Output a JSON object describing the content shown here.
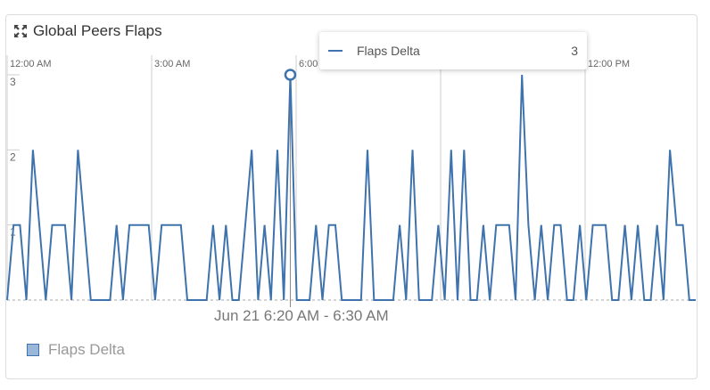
{
  "panel": {
    "title": "Global Peers Flaps",
    "icon": "expand-icon"
  },
  "tooltip": {
    "series": "Flaps Delta",
    "value": "3"
  },
  "hover_range": "Jun 21 6:20 AM - 6:30 AM",
  "legend": {
    "label": "Flaps Delta",
    "color": "#9ab6d8"
  },
  "colors": {
    "line": "#3e73ad",
    "grid": "#cfcfcf"
  },
  "chart_data": {
    "type": "line",
    "title": "Global Peers Flaps",
    "x_tick_labels": [
      "12:00 AM",
      "3:00 AM",
      "6:00",
      "",
      "12:00 PM"
    ],
    "y_tick_labels": [
      "3",
      "2",
      "1"
    ],
    "ylim": [
      0,
      3
    ],
    "interval_minutes": 10,
    "series": [
      {
        "name": "Flaps Delta",
        "values": [
          0,
          1,
          1,
          0,
          2,
          1,
          0,
          1,
          1,
          1,
          0,
          2,
          1,
          0,
          0,
          0,
          0,
          1,
          0,
          1,
          1,
          1,
          1,
          0,
          1,
          1,
          1,
          1,
          0,
          0,
          0,
          0,
          1,
          0,
          1,
          0,
          0,
          1,
          2,
          0,
          1,
          0,
          2,
          0,
          3,
          0,
          0,
          0,
          1,
          0,
          1,
          1,
          0,
          0,
          0,
          0,
          2,
          0,
          0,
          0,
          0,
          1,
          0,
          2,
          0,
          0,
          0,
          1,
          0,
          2,
          0,
          2,
          0,
          0,
          1,
          0,
          1,
          1,
          1,
          0,
          3,
          1,
          0,
          1,
          0,
          1,
          1,
          0,
          0,
          1,
          0,
          1,
          1,
          1,
          0,
          0,
          1,
          0,
          1,
          0,
          0,
          1,
          0,
          2,
          1,
          1,
          0,
          0
        ]
      }
    ],
    "hover": {
      "index": 44,
      "value": 3
    },
    "grid": true,
    "legend_position": "bottom-left"
  }
}
